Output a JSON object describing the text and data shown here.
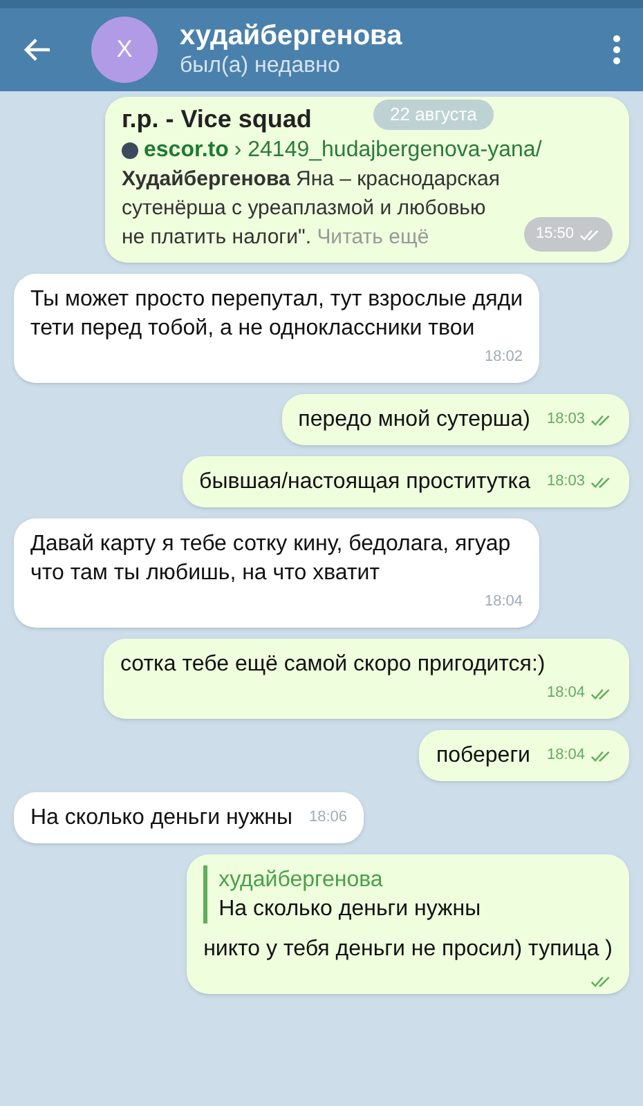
{
  "header": {
    "avatar_letter": "Х",
    "name": "худайбергенова",
    "status": "был(а) недавно"
  },
  "date_pill": "22 августа",
  "messages": [
    {
      "kind": "link_preview",
      "outgoing": true,
      "title": "г.р. - Vice squad",
      "site": "escor.to",
      "path": "› 24149_hudajbergenova-yana/",
      "description": "**Худайбергенова** Яна – краснодарская сутенёрша с уреаплазмой и любовью не платить налоги\".",
      "read_more": "Читать ещё",
      "time": "15:50",
      "read": true
    },
    {
      "kind": "text",
      "outgoing": false,
      "text": "Ты может просто перепутал, тут взрослые дяди тети перед тобой, а не одноклассники твои",
      "time": "18:02"
    },
    {
      "kind": "text",
      "outgoing": true,
      "text": "передо мной сутерша)",
      "time": "18:03",
      "read": true
    },
    {
      "kind": "text",
      "outgoing": true,
      "text": "бывшая/настоящая проститутка",
      "time": "18:03",
      "read": true
    },
    {
      "kind": "text",
      "outgoing": false,
      "text": "Давай карту я тебе сотку кину, бедолага, ягуар что там ты любишь, на что хватит",
      "time": "18:04"
    },
    {
      "kind": "text",
      "outgoing": true,
      "text": "сотка тебе ещё самой скоро пригодится:)",
      "time": "18:04",
      "read": true
    },
    {
      "kind": "text",
      "outgoing": true,
      "text": "побереги",
      "time": "18:04",
      "read": true
    },
    {
      "kind": "text",
      "outgoing": false,
      "text": "На сколько деньги нужны",
      "time": "18:06"
    },
    {
      "kind": "reply",
      "outgoing": true,
      "quote_author": "худайбергенова",
      "quote_text": "На сколько деньги нужны",
      "text": "никто у тебя деньги не просил) тупица )",
      "read": true
    }
  ]
}
